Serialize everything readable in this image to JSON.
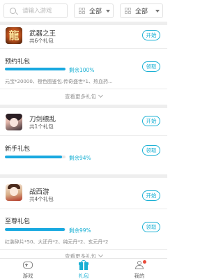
{
  "search": {
    "placeholder": "请输入游戏"
  },
  "filters": [
    {
      "label": "全部"
    },
    {
      "label": "全部"
    }
  ],
  "games": [
    {
      "name": "武器之王",
      "count_text": "共6个礼包",
      "icon_glyph": "龍",
      "start_label": "开始",
      "pack": {
        "name": "预约礼包",
        "remaining": "剩余100%",
        "progress": 1.0,
        "desc": "元宝*20000、橙色图鉴包.传奇盛世*1、热血药...",
        "get_label": "领取"
      },
      "more_label": "查看更多礼包"
    },
    {
      "name": "刀剑缥乱",
      "count_text": "共1个礼包",
      "start_label": "开始",
      "pack": {
        "name": "新手礼包",
        "remaining": "剩余94%",
        "progress": 0.94,
        "desc": "",
        "get_label": "领取"
      },
      "more_label": ""
    },
    {
      "name": "战西游",
      "count_text": "共4个礼包",
      "start_label": "开始",
      "pack": {
        "name": "至尊礼包",
        "remaining": "剩余99%",
        "progress": 0.99,
        "desc": "红装碎片*50、大还丹*2、纯元丹*2、玄元丹*2",
        "get_label": "领取"
      },
      "more_label": "查看更多礼包"
    }
  ],
  "tabs": [
    {
      "label": "游戏",
      "icon": "gamepad-icon"
    },
    {
      "label": "礼包",
      "icon": "gift-icon"
    },
    {
      "label": "我的",
      "icon": "person-icon"
    }
  ],
  "colors": {
    "accent": "#19b0d4",
    "progress": "#19a9e0",
    "badge": "#e84a3a"
  }
}
